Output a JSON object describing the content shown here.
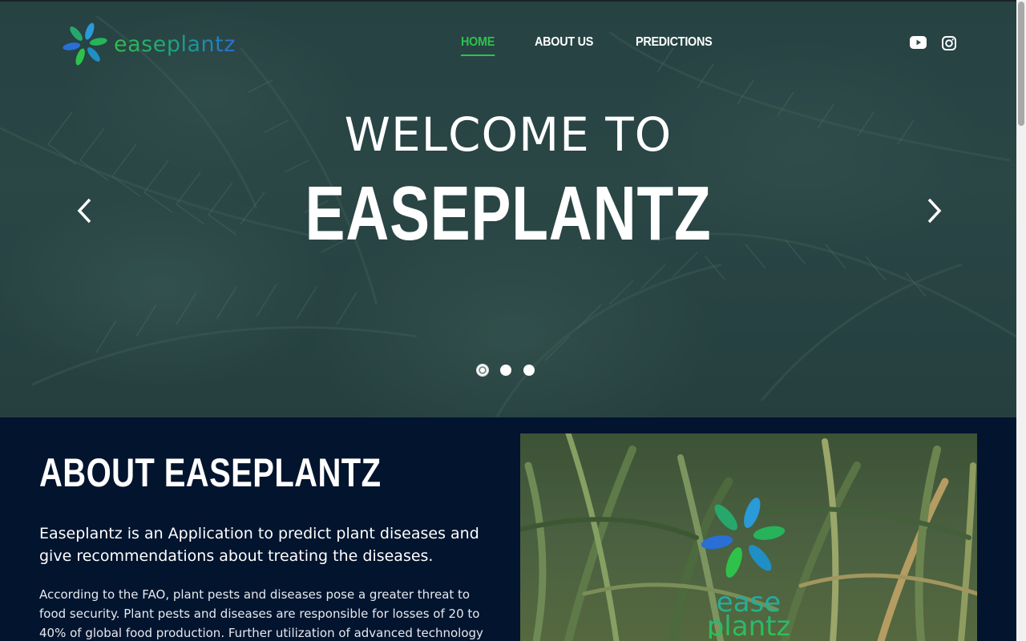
{
  "brand": {
    "logo_text": "easeplantz"
  },
  "nav": {
    "items": [
      {
        "label": "HOME",
        "active": true
      },
      {
        "label": "ABOUT US",
        "active": false
      },
      {
        "label": "PREDICTIONS",
        "active": false
      }
    ]
  },
  "social": {
    "icons": [
      "youtube-icon",
      "instagram-icon"
    ]
  },
  "hero": {
    "welcome": "WELCOME TO",
    "title": "EASEPLANTZ",
    "slides": 3,
    "active_slide": 1
  },
  "about": {
    "title": "ABOUT EASEPLANTZ",
    "lead": "Easeplantz is an Application to predict plant diseases and give recommendations about treating the diseases.",
    "body": "According to the FAO, plant pests and diseases pose a greater threat to food security. Plant pests and diseases are responsible for losses of 20 to 40% of global food production. Further utilization of advanced technology is helping",
    "image_logo_line1": "ease",
    "image_logo_line2": "plantz"
  },
  "colors": {
    "accent": "#2ec24b",
    "dark_bg": "#02142e"
  }
}
